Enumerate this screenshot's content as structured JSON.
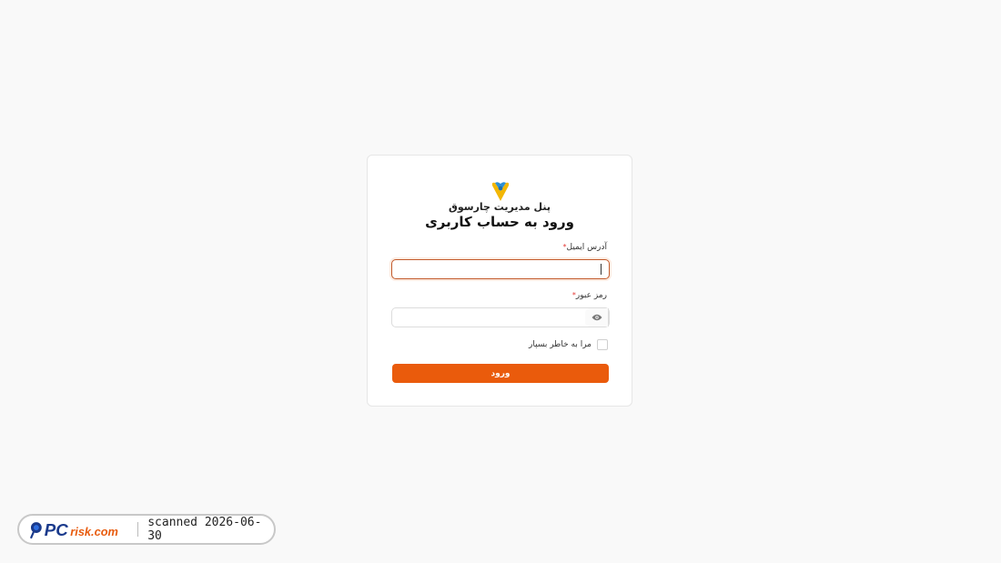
{
  "brand": {
    "name": "پنل مدیریت چارسوق"
  },
  "login": {
    "title": "ورود به حساب کاربری",
    "email_label": "آدرس ایمیل",
    "password_label": "رمز عبور",
    "required_mark": "*",
    "remember_label": "مرا به خاطر بسپار",
    "submit_label": "ورود"
  },
  "watermark": {
    "text": "scanned 2026-06-30",
    "logo_text": "PCrisk.com"
  },
  "colors": {
    "accent": "#ea5b0c",
    "background": "#f9f9f9"
  },
  "icons": [
    "brand-logo-icon",
    "eye-icon",
    "pcrisk-logo-icon"
  ]
}
